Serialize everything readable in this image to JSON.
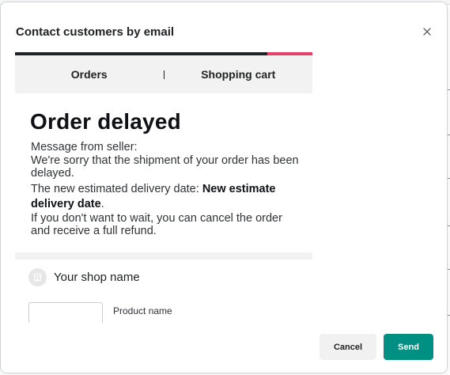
{
  "modal": {
    "title": "Contact customers by email",
    "close_icon": "close-icon"
  },
  "preview": {
    "colors": {
      "topbar": "#202223",
      "accent": "#e4416b"
    },
    "tabs": [
      {
        "label": "Orders"
      },
      {
        "label": "Shopping cart"
      }
    ],
    "heading": "Order delayed",
    "body": {
      "line1": "Message from seller:",
      "line2": "We're sorry that the shipment of your order has been delayed.",
      "date_prefix": "The new estimated delivery date:",
      "date_value": "New estimate delivery date",
      "date_suffix": ".",
      "line4": "If you don't want to wait, you can cancel the order and receive a full refund."
    },
    "shop": {
      "icon": "store-icon",
      "name": "Your shop name"
    },
    "product": {
      "name": "Product name"
    }
  },
  "footer": {
    "cancel_label": "Cancel",
    "send_label": "Send",
    "send_color": "#008f83"
  }
}
